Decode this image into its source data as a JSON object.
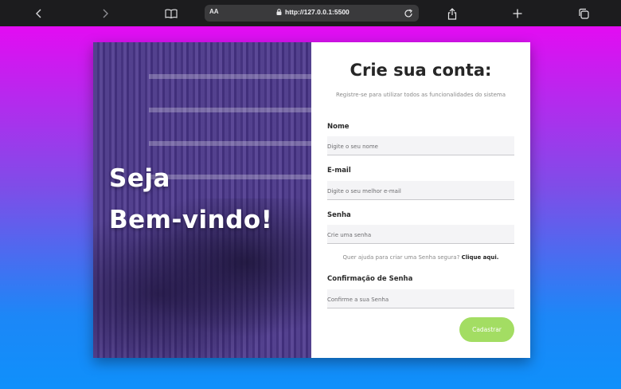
{
  "browser": {
    "text_size_label": "AA",
    "url": "http://127.0.0.1:5500"
  },
  "hero": {
    "line1": "Seja",
    "line2": "Bem-vindo!"
  },
  "form": {
    "title": "Crie sua conta:",
    "subtitle": "Registre-se para utilizar todos as funcionalidades do sistema",
    "name_label": "Nome",
    "name_placeholder": "Digite o seu nome",
    "email_label": "E-mail",
    "email_placeholder": "Digite o seu melhor e-mail",
    "password_label": "Senha",
    "password_placeholder": "Crie uma senha",
    "help_text": "Quer ajuda para criar uma Senha segura?",
    "help_link": "Clique aqui.",
    "confirm_label": "Confirmação de Senha",
    "confirm_placeholder": "Confirme a sua Senha",
    "submit_label": "Cadastrar"
  },
  "colors": {
    "gradient_top": "#e30cf2",
    "gradient_bottom": "#0f90fb",
    "submit_button": "#a3dd63",
    "hero_overlay": "#483096"
  }
}
